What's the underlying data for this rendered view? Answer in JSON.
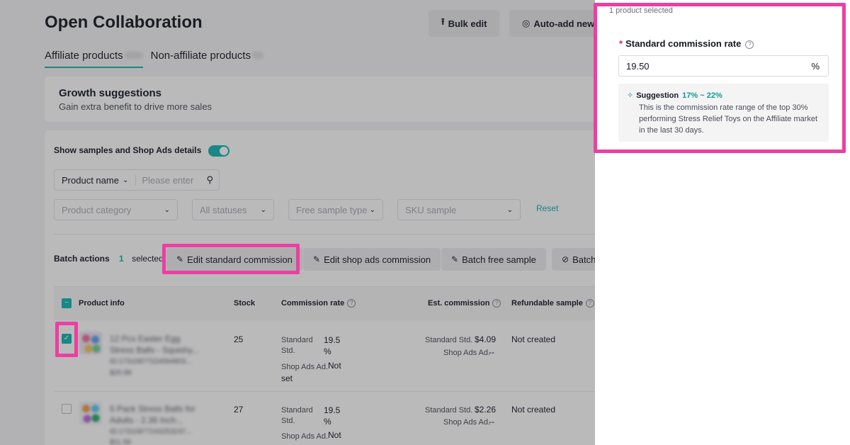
{
  "page": {
    "title": "Open Collaboration",
    "top_buttons": {
      "bulk_edit": "Bulk edit",
      "auto_add": "Auto-add new"
    },
    "tabs": [
      {
        "label": "Affiliate products"
      },
      {
        "label": "Non-affiliate products"
      }
    ],
    "growth": {
      "title": "Growth suggestions",
      "subtitle": "Gain extra benefit to drive more sales"
    },
    "toggle_label": "Show samples and Shop Ads details",
    "filters": {
      "product_name": "Product name",
      "search_placeholder": "Please enter",
      "category": "Product category",
      "status": "All statuses",
      "sample_type": "Free sample type",
      "sku": "SKU sample",
      "reset": "Reset"
    },
    "batch": {
      "label": "Batch actions",
      "count": "1",
      "selected": "selected",
      "edit_standard": "Edit standard commission",
      "edit_shop_ads": "Edit shop ads commission",
      "free_sample": "Batch free sample",
      "batch_more": "Batch"
    },
    "table": {
      "headers": {
        "product_info": "Product info",
        "stock": "Stock",
        "commission_rate": "Commission rate",
        "est_commission": "Est. commission",
        "refundable": "Refundable sample"
      },
      "rows": [
        {
          "name_line1": "12 Pcs Easter Egg",
          "name_line2": "Stress Balls - Squishy...",
          "id": "ID:17310877224594803...",
          "price": "$20.99",
          "stock": "25",
          "std_label": "Standard Std.",
          "std_value": "19.5 %",
          "ads_label": "Shop Ads Ad.",
          "ads_value": "Not set",
          "est_std_label": "Standard Std.",
          "est_std_value": "$4.09",
          "est_ads_label": "Shop Ads Ad.",
          "est_ads_value": "--",
          "refundable": "Not created"
        },
        {
          "name_line1": "5 Pack Stress Balls for",
          "name_line2": "Adults - 2.36 Inch...",
          "id": "ID:17310877243253237...",
          "price": "$11.59",
          "stock": "27",
          "std_label": "Standard Std.",
          "std_value": "19.5 %",
          "ads_label": "Shop Ads Ad.",
          "ads_value": "Not set",
          "est_std_label": "Standard Std.",
          "est_std_value": "$2.26",
          "est_ads_label": "Shop Ads Ad.",
          "est_ads_value": "--",
          "refundable": "Not created"
        }
      ]
    }
  },
  "drawer": {
    "header": "1 product selected",
    "required_mark": "*",
    "label": "Standard commission rate",
    "input_value": "19.50",
    "unit": "%",
    "suggestion_title": "Suggestion",
    "suggestion_range": "17% ~ 22%",
    "suggestion_body": "This is the commission rate range of the top 30% performing Stress Relief Toys on the Affiliate market in the last 30 days."
  },
  "colors": {
    "accent": "#0fb5b0",
    "highlight": "#ec3fa2"
  },
  "icons": {
    "bulk_edit": "upload-icon",
    "auto_add": "target-icon",
    "edit": "edit-icon",
    "ban": "ban-icon",
    "help": "help-icon",
    "search": "search-icon",
    "chevron": "chevron-down-icon",
    "magic": "magic-wand-icon"
  }
}
